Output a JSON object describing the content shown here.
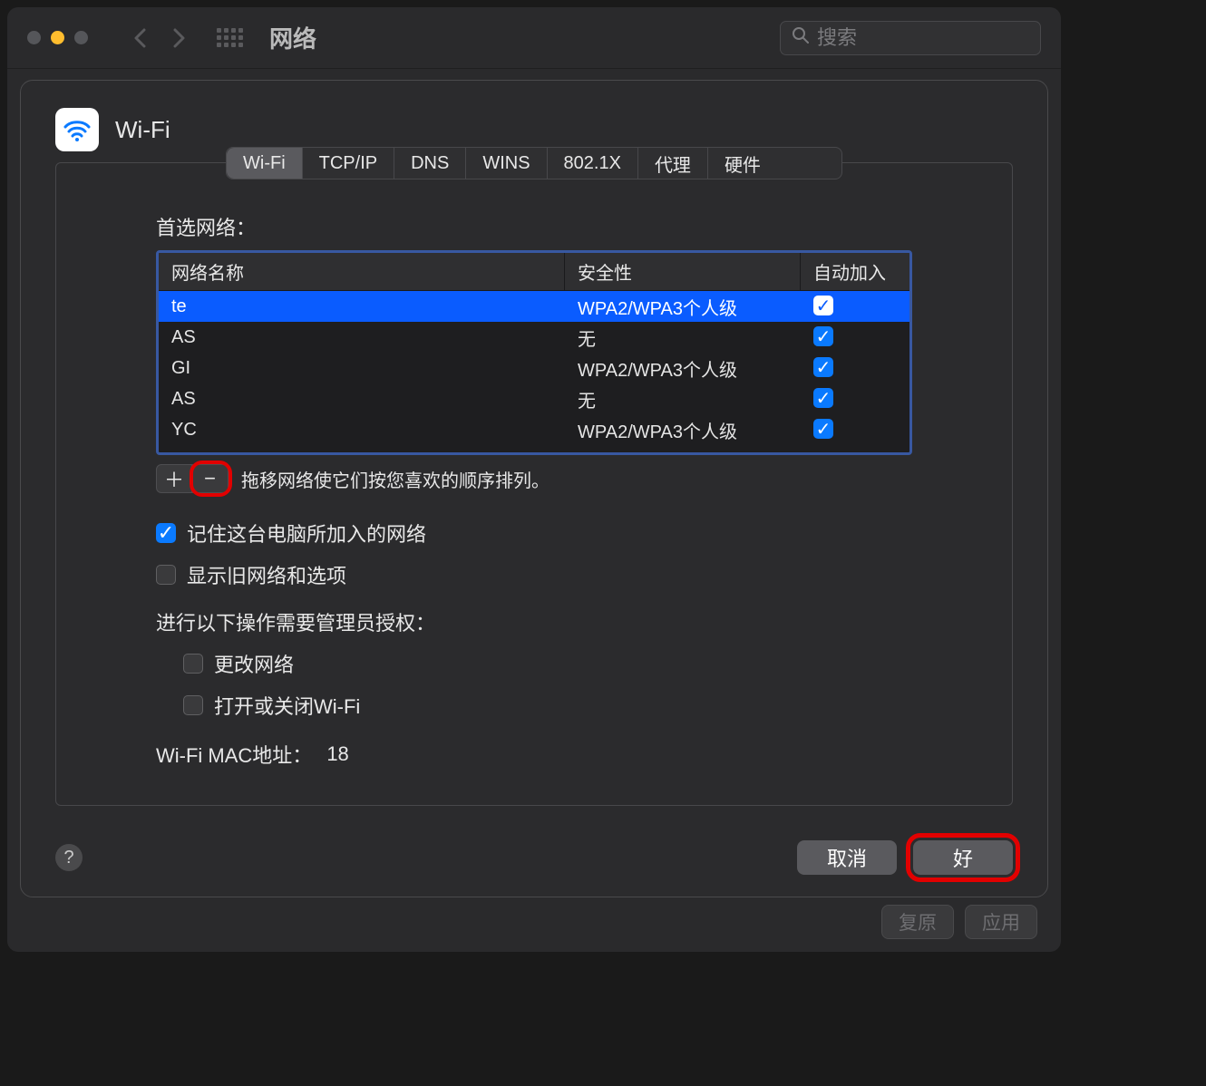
{
  "titlebar": {
    "title": "网络",
    "search_placeholder": "搜索"
  },
  "sheet": {
    "title": "Wi-Fi",
    "tabs": [
      "Wi-Fi",
      "TCP/IP",
      "DNS",
      "WINS",
      "802.1X",
      "代理",
      "硬件"
    ],
    "active_tab": 0,
    "preferred_networks_label": "首选网络：",
    "columns": {
      "name": "网络名称",
      "security": "安全性",
      "auto_join": "自动加入"
    },
    "rows": [
      {
        "name": "te",
        "security": "WPA2/WPA3个人级",
        "auto_join": true,
        "selected": true
      },
      {
        "name": "AS",
        "security": "无",
        "auto_join": true,
        "selected": false
      },
      {
        "name": "GI",
        "security": "WPA2/WPA3个人级",
        "auto_join": true,
        "selected": false
      },
      {
        "name": "AS",
        "security": "无",
        "auto_join": true,
        "selected": false
      },
      {
        "name": "YC",
        "security": "WPA2/WPA3个人级",
        "auto_join": true,
        "selected": false
      }
    ],
    "drag_hint": "拖移网络使它们按您喜欢的顺序排列。",
    "remember_label": "记住这台电脑所加入的网络",
    "remember_checked": true,
    "show_legacy_label": "显示旧网络和选项",
    "show_legacy_checked": false,
    "admin_label": "进行以下操作需要管理员授权：",
    "admin_change_networks": "更改网络",
    "admin_change_networks_checked": false,
    "admin_toggle_wifi": "打开或关闭Wi-Fi",
    "admin_toggle_wifi_checked": false,
    "mac_label": "Wi-Fi MAC地址：",
    "mac_value": "18",
    "cancel": "取消",
    "ok": "好"
  },
  "behind": {
    "revert": "复原",
    "apply": "应用"
  }
}
